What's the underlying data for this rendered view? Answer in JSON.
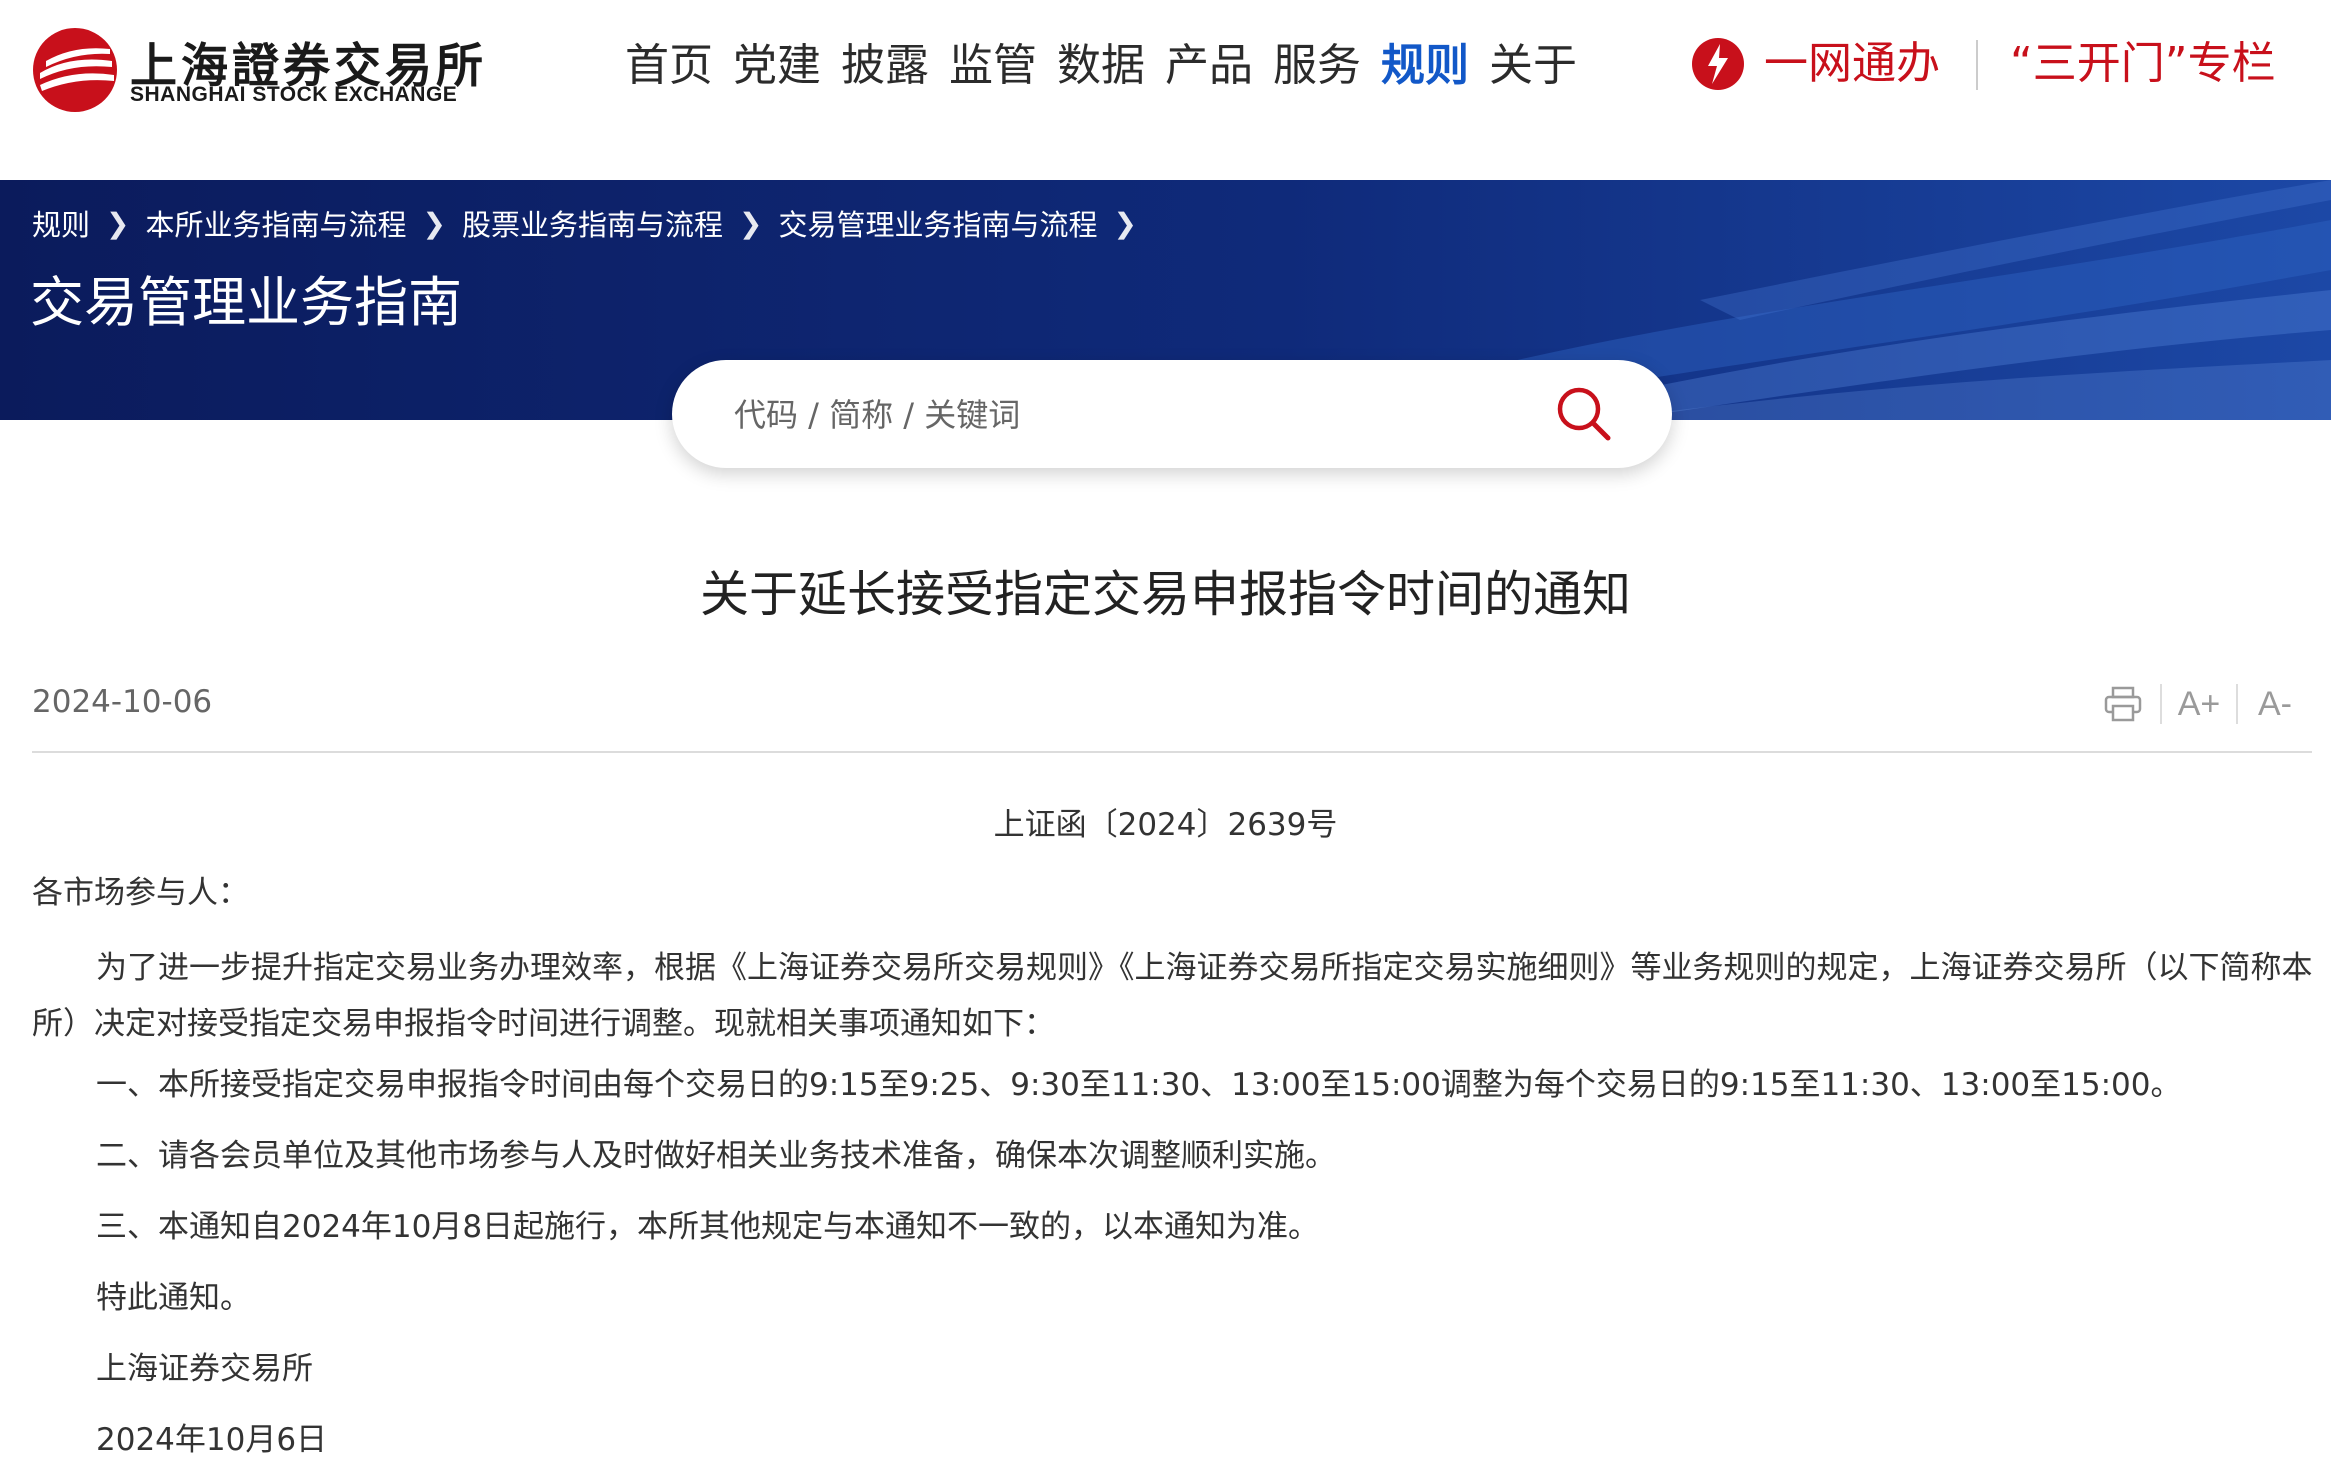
{
  "header": {
    "logo_cn": "上海證券交易所",
    "logo_en": "SHANGHAI STOCK EXCHANGE",
    "nav": [
      "首页",
      "党建",
      "披露",
      "监管",
      "数据",
      "产品",
      "服务",
      "规则",
      "关于"
    ],
    "nav_active": "规则",
    "service_label": "一网通办",
    "column_label": "“三开门”专栏",
    "brand_color": "#c8101b",
    "active_color": "#1258c8"
  },
  "banner": {
    "breadcrumb": [
      "规则",
      "本所业务指南与流程",
      "股票业务指南与流程",
      "交易管理业务指南与流程"
    ],
    "heading": "交易管理业务指南"
  },
  "search": {
    "placeholder": "代码 / 简称 / 关键词",
    "icon": "search-icon"
  },
  "article": {
    "title": "关于延长接受指定交易申报指令时间的通知",
    "date": "2024-10-06",
    "tools": {
      "print_icon": "printer-icon",
      "font_increase": "A+",
      "font_decrease": "A-"
    },
    "doc_number": "上证函〔2024〕2639号",
    "salutation": "各市场参与人：",
    "intro": "为了进一步提升指定交易业务办理效率，根据《上海证券交易所交易规则》《上海证券交易所指定交易实施细则》等业务规则的规定，上海证券交易所（以下简称本所）决定对接受指定交易申报指令时间进行调整。现就相关事项通知如下：",
    "items": [
      "一、本所接受指定交易申报指令时间由每个交易日的9:15至9:25、9:30至11:30、13:00至15:00调整为每个交易日的9:15至11:30、13:00至15:00。",
      "二、请各会员单位及其他市场参与人及时做好相关业务技术准备，确保本次调整顺利实施。",
      "三、本通知自2024年10月8日起施行，本所其他规定与本通知不一致的，以本通知为准。"
    ],
    "closing": "特此通知。",
    "signature": "上海证券交易所",
    "sign_date": "2024年10月6日"
  }
}
